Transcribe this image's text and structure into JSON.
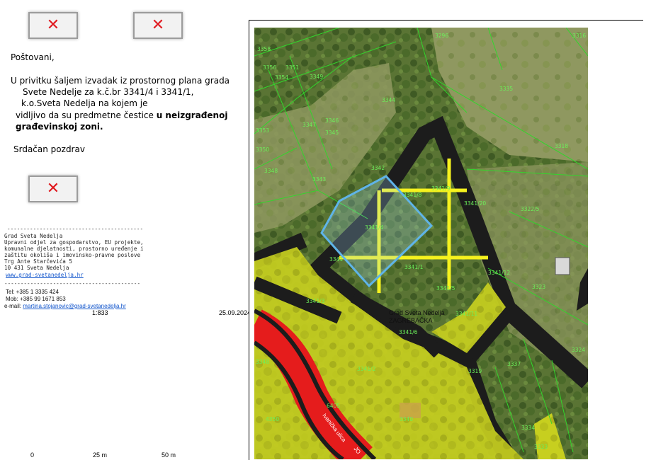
{
  "email": {
    "greeting": "Poštovani,",
    "body_line1": "U privitku šaljem izvadak iz prostornog plana grada",
    "body_line2": "Svete Nedelje za k.č.br 3341/4 i 3341/1,",
    "body_line3": "k.o.Sveta Nedelja na kojem je",
    "body_line4_prefix": "vidljivo da su predmetne čestice ",
    "body_line4_bold": "u neizgrađenoj",
    "body_line5_bold": "građevinskoj zoni.",
    "closing": "Srdačan pozdrav"
  },
  "signature": {
    "divider_top": "------------------------------------------",
    "org": "Grad Sveta Nedelja",
    "dept_line1": "Upravni odjel za gospodarstvo, EU projekte,",
    "dept_line2": "komunalne djelatnosti, prostorno uređenje i",
    "dept_line3": "zaštitu okoliša i imovinsko-pravne poslove",
    "address_street": "Trg Ante Starčevića 5",
    "address_city": "10 431 Sveta Nedelja",
    "website": "www.grad-svetanedelja.hr",
    "divider_bottom": "------------------------------------------",
    "tel": "Tel: +385 1 3335 424",
    "mob": "Mob: +385 99 1671 853",
    "email_label": "e-mail: ",
    "email_address": "martina.stojanovic@grad-svetanedelja.hr"
  },
  "map": {
    "scale_ratio": "1:833",
    "date": "25.09.2024.",
    "scale_bar": {
      "zero": "0",
      "mid": "25 m",
      "end": "50 m"
    },
    "place_label_line1": "Grad Sveta Nedelja",
    "place_label_line2": "ZAGREBAČKA",
    "road_label": "Ivanička ulica",
    "road_label_2": "JO",
    "parcels": [
      {
        "label": "3296"
      },
      {
        "label": "3316"
      },
      {
        "label": "3358"
      },
      {
        "label": "3356"
      },
      {
        "label": "3351"
      },
      {
        "label": "3354"
      },
      {
        "label": "3349"
      },
      {
        "label": "3335"
      },
      {
        "label": "3344"
      },
      {
        "label": "3347"
      },
      {
        "label": "3346"
      },
      {
        "label": "3345"
      },
      {
        "label": "3353"
      },
      {
        "label": "3350"
      },
      {
        "label": "3318"
      },
      {
        "label": "3348"
      },
      {
        "label": "3342"
      },
      {
        "label": "3343"
      },
      {
        "label": "3341/9"
      },
      {
        "label": "3341/8"
      },
      {
        "label": "3341/20"
      },
      {
        "label": "3322/5"
      },
      {
        "label": "3341/4"
      },
      {
        "label": "3341"
      },
      {
        "label": "3341/1"
      },
      {
        "label": "3341/12"
      },
      {
        "label": "3323"
      },
      {
        "label": "3341/3"
      },
      {
        "label": "3341/5"
      },
      {
        "label": "3341/11"
      },
      {
        "label": "3341/6"
      },
      {
        "label": "3348"
      },
      {
        "label": "3341/2"
      },
      {
        "label": "3319"
      },
      {
        "label": "3337"
      },
      {
        "label": "3324"
      },
      {
        "label": "6405"
      },
      {
        "label": "4350"
      },
      {
        "label": "3340"
      },
      {
        "label": "3334"
      },
      {
        "label": "3333"
      }
    ]
  },
  "colors": {
    "plot_yellow": "#d8dc1e",
    "road_black": "#1c1c1c",
    "road_red": "#e51c1c",
    "parcel_line": "#32d62c",
    "parcel_label": "#6cf05a",
    "highlight_blue": "#5fb4e8",
    "grid_yellow": "#f6f21e",
    "aerial_green": "#5d7a38"
  },
  "images": {
    "broken_icon": "broken-image-icon"
  }
}
